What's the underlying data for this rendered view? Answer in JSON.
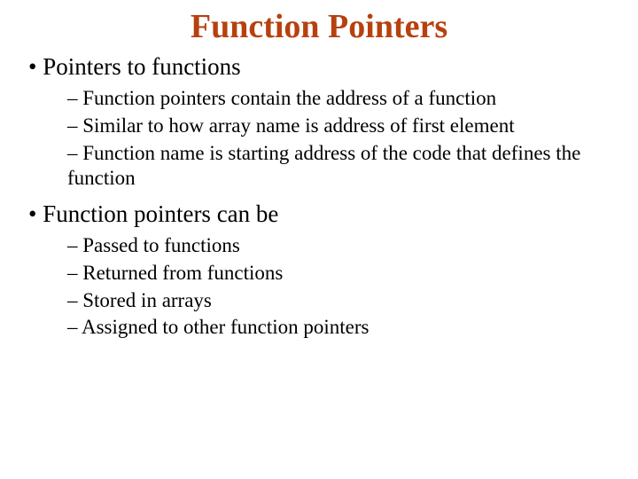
{
  "title": "Function Pointers",
  "bullets": {
    "b1": {
      "label": "Pointers to functions",
      "subs": {
        "s1": "Function pointers contain the address of a function",
        "s2": "Similar to how array name is address of first element",
        "s3": "Function name is starting address of the code that defines the function"
      }
    },
    "b2": {
      "label": "Function pointers can be",
      "subs": {
        "s1": "Passed to functions",
        "s2": "Returned from functions",
        "s3": "Stored in arrays",
        "s4": "Assigned to other function pointers"
      }
    }
  }
}
